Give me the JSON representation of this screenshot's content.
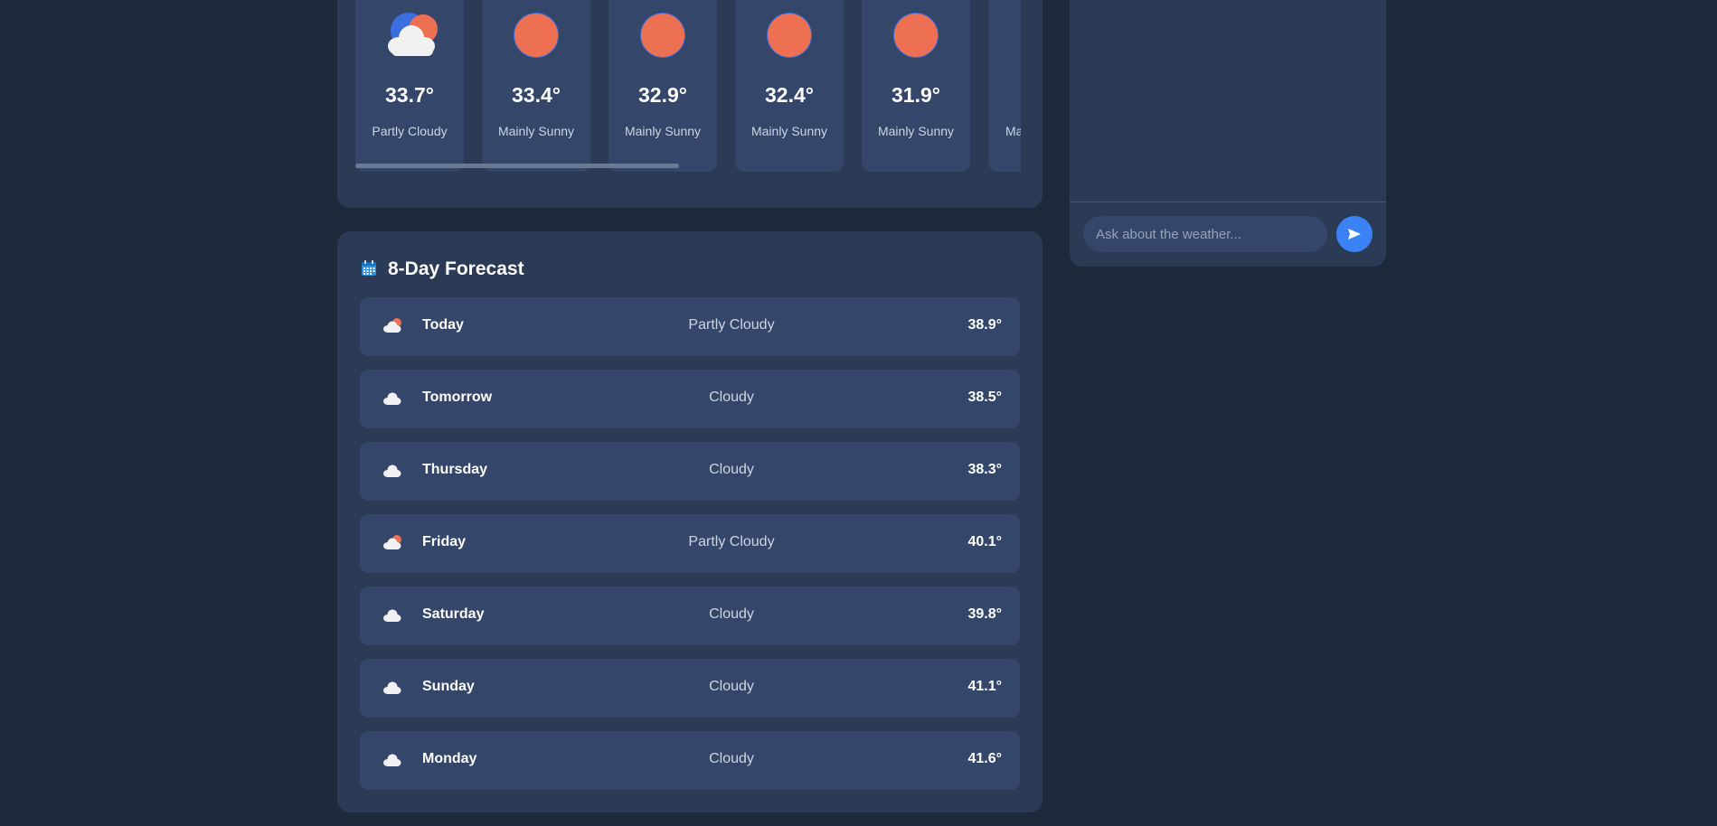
{
  "hourly": {
    "cards": [
      {
        "temp": "33.7°",
        "condition": "Partly Cloudy",
        "icon": "partly-cloudy-icon"
      },
      {
        "temp": "33.4°",
        "condition": "Mainly Sunny",
        "icon": "sun-icon"
      },
      {
        "temp": "32.9°",
        "condition": "Mainly Sunny",
        "icon": "sun-icon"
      },
      {
        "temp": "32.4°",
        "condition": "Mainly Sunny",
        "icon": "sun-icon"
      },
      {
        "temp": "31.9°",
        "condition": "Mainly Sunny",
        "icon": "sun-icon"
      },
      {
        "temp": "",
        "condition": "Ma",
        "icon": ""
      }
    ],
    "scroll_position_fraction": 0.0
  },
  "forecast": {
    "title": "8-Day Forecast",
    "title_icon": "calendar-icon",
    "days": [
      {
        "day": "Today",
        "condition": "Partly Cloudy",
        "temp": "38.9°",
        "icon": "partly-cloudy-icon"
      },
      {
        "day": "Tomorrow",
        "condition": "Cloudy",
        "temp": "38.5°",
        "icon": "cloud-icon"
      },
      {
        "day": "Thursday",
        "condition": "Cloudy",
        "temp": "38.3°",
        "icon": "cloud-icon"
      },
      {
        "day": "Friday",
        "condition": "Partly Cloudy",
        "temp": "40.1°",
        "icon": "partly-cloudy-icon"
      },
      {
        "day": "Saturday",
        "condition": "Cloudy",
        "temp": "39.8°",
        "icon": "cloud-icon"
      },
      {
        "day": "Sunday",
        "condition": "Cloudy",
        "temp": "41.1°",
        "icon": "cloud-icon"
      },
      {
        "day": "Monday",
        "condition": "Cloudy",
        "temp": "41.6°",
        "icon": "cloud-icon"
      }
    ]
  },
  "chat": {
    "input_placeholder": "Ask about the weather...",
    "input_value": "",
    "send_icon": "send-icon"
  },
  "colors": {
    "background": "#1e293b",
    "panel": "#2b3a55",
    "card": "#34466a",
    "accent": "#3b82f6",
    "sun": "#ed7052"
  }
}
